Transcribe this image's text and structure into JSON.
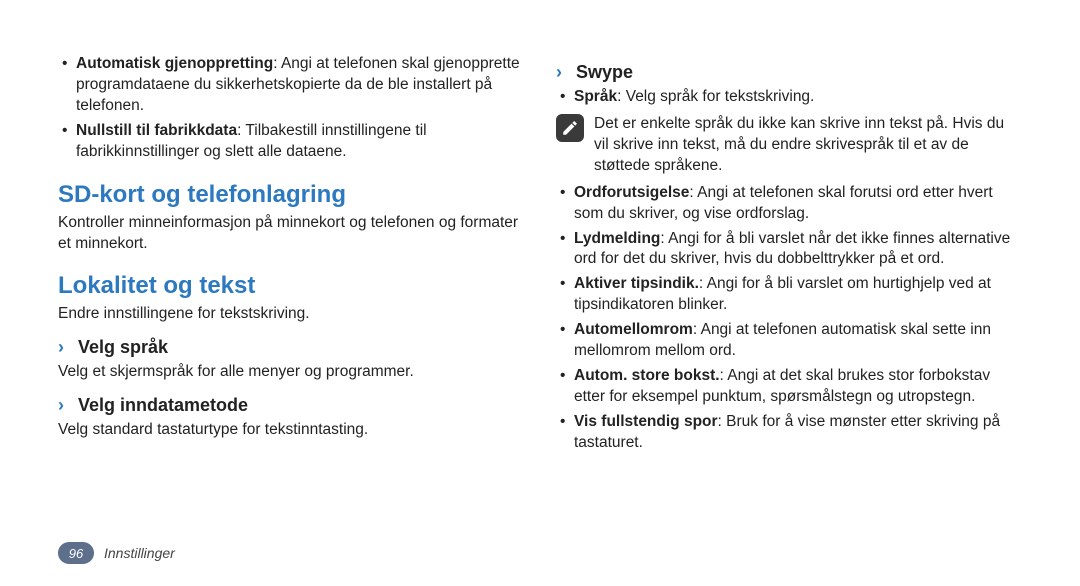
{
  "col_left": {
    "restore_bullets": [
      {
        "lead": "Automatisk gjenoppretting",
        "text": ": Angi at telefonen skal gjenopprette programdataene du sikkerhetskopierte da de ble installert på telefonen."
      },
      {
        "lead": "Nullstill til fabrikkdata",
        "text": ": Tilbakestill innstillingene til fabrikkinnstillinger og slett alle dataene."
      }
    ],
    "h1_sd": "SD-kort og telefonlagring",
    "sd_para": "Kontroller minneinformasjon på minnekort og telefonen og formater et minnekort.",
    "h1_loc": "Lokalitet og tekst",
    "loc_para": "Endre innstillingene for tekstskriving.",
    "h2_lang": "Velg språk",
    "lang_para": "Velg et skjermspråk for alle menyer og programmer.",
    "h2_input": "Velg inndatametode",
    "input_para": "Velg standard tastaturtype for tekstinntasting."
  },
  "col_right": {
    "h2_swype": "Swype",
    "swype_lang_bullet": {
      "lead": "Språk",
      "text": ": Velg språk for tekstskriving."
    },
    "note_text": "Det er enkelte språk du ikke kan skrive inn tekst på. Hvis du vil skrive inn tekst, må du endre skrivespråk til et av de støttede språkene.",
    "swype_bullets": [
      {
        "lead": "Ordforutsigelse",
        "text": ": Angi at telefonen skal forutsi ord etter hvert som du skriver, og vise ordforslag."
      },
      {
        "lead": "Lydmelding",
        "text": ": Angi for å bli varslet når det ikke finnes alternative ord for det du skriver, hvis du dobbelttrykker på et ord."
      },
      {
        "lead": "Aktiver tipsindik.",
        "text": ": Angi for å bli varslet om hurtighjelp ved at tipsindikatoren blinker."
      },
      {
        "lead": "Automellomrom",
        "text": ": Angi at telefonen automatisk skal sette inn mellomrom mellom ord."
      },
      {
        "lead": "Autom. store bokst.",
        "text": ": Angi at det skal brukes stor forbokstav etter for eksempel punktum, spørsmålstegn og utropstegn."
      },
      {
        "lead": "Vis fullstendig spor",
        "text": ": Bruk for å vise mønster etter skriving på tastaturet."
      }
    ]
  },
  "footer": {
    "page_num": "96",
    "section": "Innstillinger"
  }
}
